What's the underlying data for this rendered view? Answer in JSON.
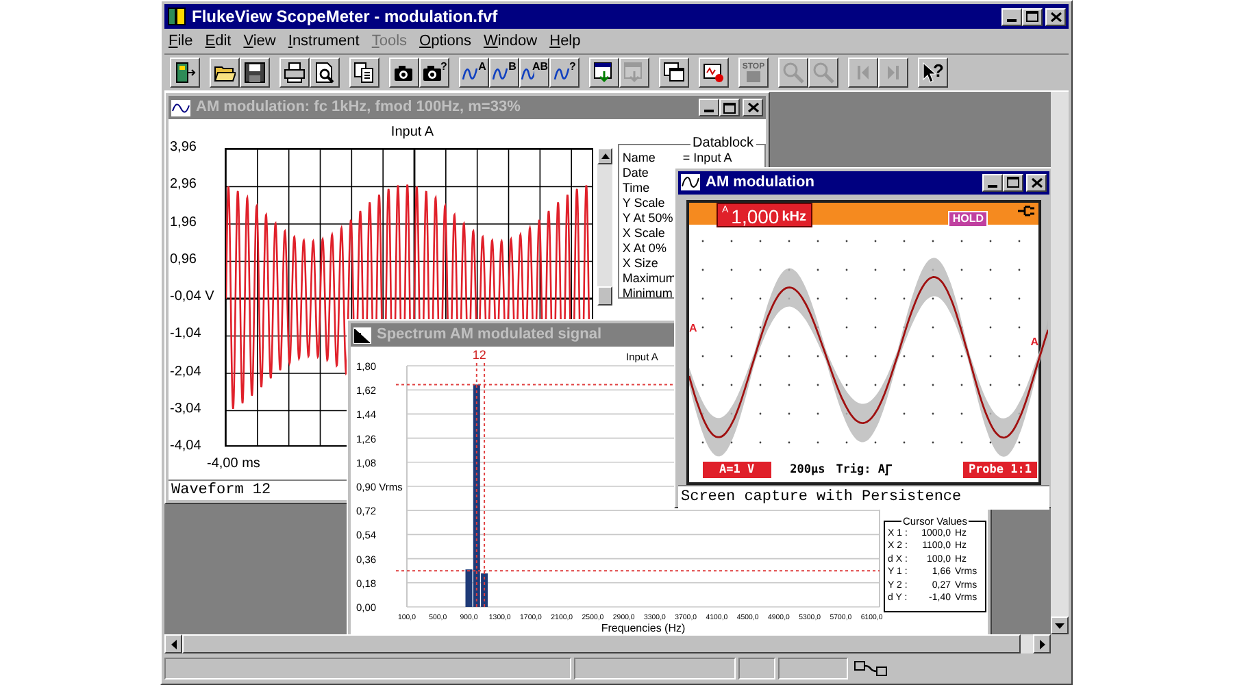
{
  "app": {
    "title": "FlukeView ScopeMeter - modulation.fvf"
  },
  "menu": [
    {
      "label": "File",
      "disabled": false
    },
    {
      "label": "Edit",
      "disabled": false
    },
    {
      "label": "View",
      "disabled": false
    },
    {
      "label": "Instrument",
      "disabled": false
    },
    {
      "label": "Tools",
      "disabled": true
    },
    {
      "label": "Options",
      "disabled": false
    },
    {
      "label": "Window",
      "disabled": false
    },
    {
      "label": "Help",
      "disabled": false
    }
  ],
  "toolbar": [
    [
      {
        "kind": "book",
        "disabled": false
      }
    ],
    [
      {
        "kind": "folder",
        "disabled": false
      },
      {
        "kind": "save",
        "disabled": false
      }
    ],
    [
      {
        "kind": "print",
        "disabled": false
      },
      {
        "kind": "preview",
        "disabled": false
      }
    ],
    [
      {
        "kind": "copy",
        "disabled": false
      }
    ],
    [
      {
        "kind": "camera",
        "disabled": false
      },
      {
        "kind": "camera",
        "badge": "?",
        "disabled": false
      }
    ],
    [
      {
        "kind": "wave",
        "badge": "A",
        "disabled": false
      },
      {
        "kind": "wave",
        "badge": "B",
        "disabled": false
      },
      {
        "kind": "wave",
        "badge": "AB",
        "disabled": false
      },
      {
        "kind": "wave",
        "badge": "?",
        "disabled": false
      }
    ],
    [
      {
        "kind": "import",
        "disabled": false
      },
      {
        "kind": "import",
        "disabled": true
      }
    ],
    [
      {
        "kind": "windows",
        "disabled": false
      }
    ],
    [
      {
        "kind": "record",
        "disabled": false
      }
    ],
    [
      {
        "kind": "stop",
        "badge": "STOP",
        "disabled": true
      }
    ],
    [
      {
        "kind": "zoom",
        "disabled": true
      },
      {
        "kind": "zoom",
        "disabled": true
      }
    ],
    [
      {
        "kind": "first",
        "disabled": true
      },
      {
        "kind": "last",
        "disabled": true
      }
    ],
    [
      {
        "kind": "help",
        "badge": "?",
        "disabled": false
      }
    ]
  ],
  "waveform_window": {
    "title": "AM modulation: fc 1kHz, fmod 100Hz, m=33%",
    "active": false,
    "channel": "Input A",
    "yticks": [
      "3,96",
      "2,96",
      "1,96",
      "0,96",
      "-0,04 V",
      "-1,04",
      "-2,04",
      "-3,04",
      "-4,04"
    ],
    "x_start": "-4,00 ms",
    "datablock": {
      "title": "Datablock",
      "rows": [
        {
          "label": "Name",
          "value": "= Input A"
        },
        {
          "label": "Date"
        },
        {
          "label": "Time"
        },
        {
          "label": "Y Scale"
        },
        {
          "label": "Y At 50%"
        },
        {
          "label": "X Scale"
        },
        {
          "label": "X At 0%"
        },
        {
          "label": "X Size"
        },
        {
          "label": "Maximum"
        },
        {
          "label": "Minimum"
        }
      ]
    },
    "status": "Waveform 12"
  },
  "spectrum_window": {
    "title": "Spectrum  AM modulated signal",
    "active": false,
    "cursor_label": "12",
    "chart_data": {
      "type": "bar",
      "xlabel": "Frequencies (Hz)",
      "x": [
        900,
        1000,
        1100
      ],
      "series": [
        {
          "name": "Input A",
          "color": "#1e3a78",
          "values": [
            0.28,
            1.66,
            0.25
          ]
        }
      ],
      "xlim": [
        100,
        6200
      ],
      "ylim": [
        0,
        1.8
      ],
      "xticks": [
        {
          "value": 100,
          "label": "100,0"
        },
        {
          "value": 500,
          "label": "500,0"
        },
        {
          "value": 900,
          "label": "900,0"
        },
        {
          "value": 1300,
          "label": "1300,0"
        },
        {
          "value": 1700,
          "label": "1700,0"
        },
        {
          "value": 2100,
          "label": "2100,0"
        },
        {
          "value": 2500,
          "label": "2500,0"
        },
        {
          "value": 2900,
          "label": "2900,0"
        },
        {
          "value": 3300,
          "label": "3300,0"
        },
        {
          "value": 3700,
          "label": "3700,0"
        },
        {
          "value": 4100,
          "label": "4100,0"
        },
        {
          "value": 4500,
          "label": "4500,0"
        },
        {
          "value": 4900,
          "label": "4900,0"
        },
        {
          "value": 5300,
          "label": "5300,0"
        },
        {
          "value": 5700,
          "label": "5700,0"
        },
        {
          "value": 6100,
          "label": "6100,0"
        }
      ],
      "yticks": [
        {
          "value": 0,
          "label": "0,00"
        },
        {
          "value": 0.18,
          "label": "0,18"
        },
        {
          "value": 0.36,
          "label": "0,36"
        },
        {
          "value": 0.54,
          "label": "0,54"
        },
        {
          "value": 0.72,
          "label": "0,72"
        },
        {
          "value": 0.9,
          "label": "0,90 Vrms"
        },
        {
          "value": 1.08,
          "label": "1,08"
        },
        {
          "value": 1.26,
          "label": "1,26"
        },
        {
          "value": 1.44,
          "label": "1,44"
        },
        {
          "value": 1.62,
          "label": "1,62"
        },
        {
          "value": 1.8,
          "label": "1,80"
        }
      ],
      "grid": true,
      "ref_lines": [
        {
          "axis": "x",
          "value": 1000
        },
        {
          "axis": "x",
          "value": 1100
        },
        {
          "axis": "y",
          "value": 1.66
        },
        {
          "axis": "y",
          "value": 0.27
        }
      ]
    },
    "cursor_values": {
      "title": "Cursor Values",
      "rows": [
        {
          "label": "X 1 :",
          "value": "1000,0",
          "unit": "Hz"
        },
        {
          "label": "X 2 :",
          "value": "1100,0",
          "unit": "Hz"
        },
        {
          "label": "d X :",
          "value": "100,0",
          "unit": "Hz"
        },
        {
          "label": "Y 1 :",
          "value": "1,66",
          "unit": "Vrms"
        },
        {
          "label": "Y 2 :",
          "value": "0,27",
          "unit": "Vrms"
        },
        {
          "label": "d Y :",
          "value": "-1,40",
          "unit": "Vrms"
        }
      ]
    }
  },
  "scope_window": {
    "title": "AM modulation",
    "active": true,
    "frequency_channel": "A",
    "frequency": "1,000",
    "frequency_unit": "kHz",
    "hold": "HOLD",
    "marker_left": "A",
    "marker_right": "A",
    "range": "A=1 V",
    "timebase": "200µs",
    "trigger": "Trig: A",
    "probe": "Probe 1:1",
    "caption": "Screen capture with Persistence"
  }
}
